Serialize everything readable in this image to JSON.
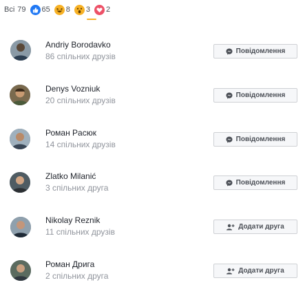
{
  "reactions": {
    "all_label": "Всі",
    "all_count": "79",
    "items": [
      {
        "name": "like",
        "icon": "like-icon",
        "color": "#2078f4",
        "count": "65"
      },
      {
        "name": "haha",
        "icon": "haha-emoji-icon",
        "color": "#f7b125",
        "count": "8"
      },
      {
        "name": "wow",
        "icon": "wow-emoji-icon",
        "color": "#f7b125",
        "count": "3"
      },
      {
        "name": "love",
        "icon": "heart-reaction-icon",
        "color": "#ed5167",
        "count": "2"
      }
    ],
    "selected_underline_color": "#f7b125"
  },
  "people": [
    {
      "name": "Andriy Borodavko",
      "mutual": "86 спільних друзів",
      "button": {
        "label": "Повідомлення",
        "icon": "messenger-icon"
      }
    },
    {
      "name": "Denys Vozniuk",
      "mutual": "20 спільних друзів",
      "button": {
        "label": "Повідомлення",
        "icon": "messenger-icon"
      }
    },
    {
      "name": "Роман Рacюк",
      "mutual": "14 спільних друзів",
      "button": {
        "label": "Повідомлення",
        "icon": "messenger-icon"
      }
    },
    {
      "name": "Zlatko Milanić",
      "mutual": "3 спільних друга",
      "button": {
        "label": "Повідомлення",
        "icon": "messenger-icon"
      }
    },
    {
      "name": "Nikolay Reznik",
      "mutual": "11 спільних друзів",
      "button": {
        "label": "Додати друга",
        "icon": "add-friend-icon"
      }
    },
    {
      "name": "Роман Дрига",
      "mutual": "2 спільних друга",
      "button": {
        "label": "Додати друга",
        "icon": "add-friend-icon"
      }
    }
  ]
}
